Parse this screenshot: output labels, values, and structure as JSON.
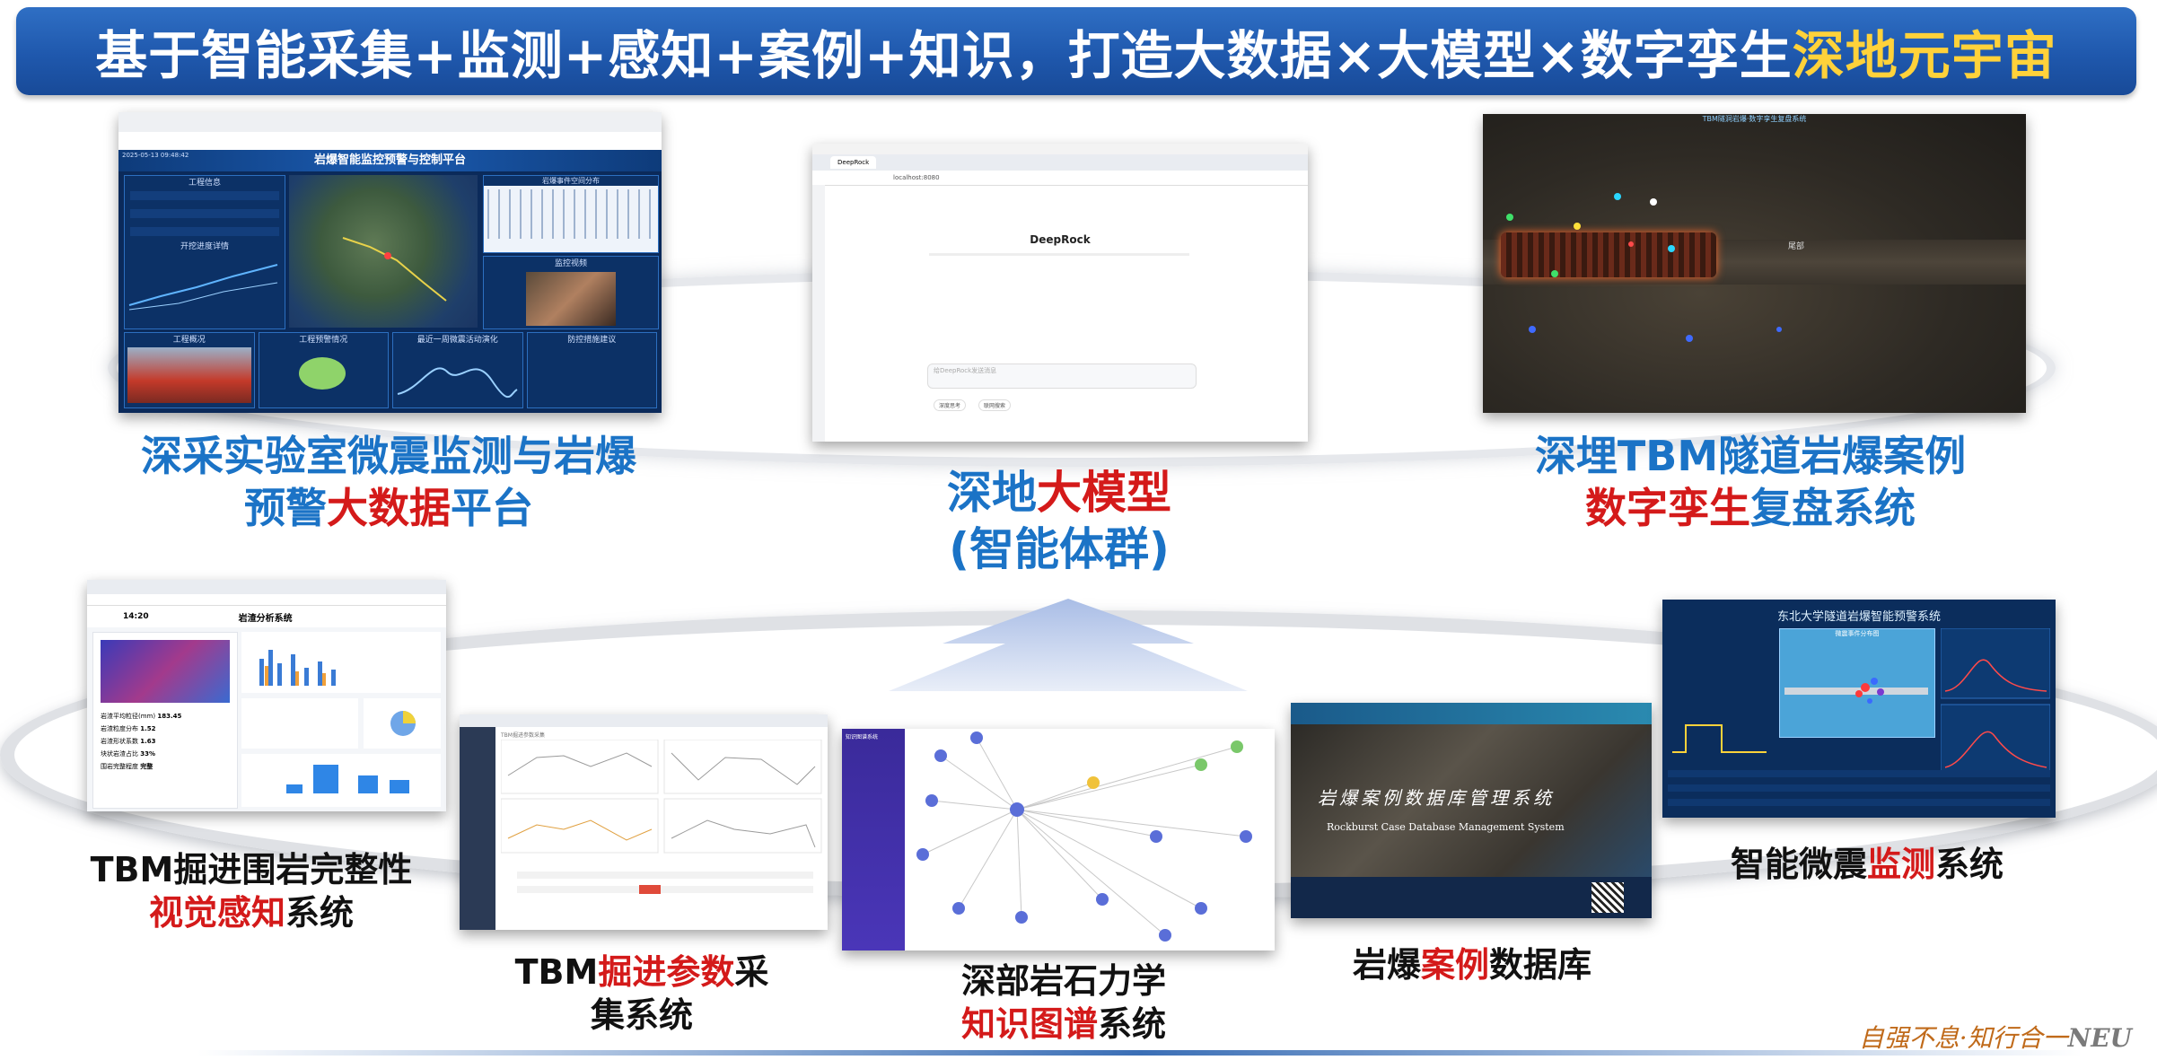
{
  "banner": {
    "main": "基于智能采集+监测+感知+案例+知识，打造大数据×大模型×数字孪生",
    "highlight": "深地元宇宙"
  },
  "captions": {
    "bigdata": {
      "l1": "深采实验室微震监测与岩爆",
      "l2a": "预警",
      "l2b": "大数据",
      "l2c": "平台"
    },
    "llm": {
      "l1a": "深地",
      "l1b": "大模型",
      "l2": "(智能体群)"
    },
    "twin": {
      "l1": "深埋TBM隧道岩爆案例",
      "l2a": "数字孪生",
      "l2b": "复盘系统"
    },
    "vision": {
      "l1": "TBM掘进围岩完整性",
      "l2a": "视觉感知",
      "l2b": "系统"
    },
    "params": {
      "l1a": "TBM",
      "l1b": "掘进参数",
      "l1c": "采",
      "l2": "集系统"
    },
    "kg": {
      "l1": "深部岩石力学",
      "l2a": "知识图谱",
      "l2b": "系统"
    },
    "casedb": {
      "l1a": "岩爆",
      "l1b": "案例",
      "l1c": "数据库"
    },
    "microseis": {
      "l1a": "智能微震",
      "l1b": "监测",
      "l1c": "系统"
    }
  },
  "screens": {
    "dashboard": {
      "title": "岩爆智能监控预警与控制平台",
      "date": "2025-05-13 09:48:42",
      "p1": "工程信息",
      "p2": "开挖进度详情",
      "p3": "岩爆事件空间分布",
      "p4": "监控视频",
      "p5": "工程概况",
      "p6": "工程预警情况",
      "p7": "最近一周微震活动演化",
      "p8": "防控措施建议"
    },
    "deeprock": {
      "tab": "DeepRock",
      "url": "localhost:8080",
      "title": "DeepRock",
      "input_placeholder": "给DeepRock发送消息",
      "btn1": "深度思考",
      "btn2": "联网搜索"
    },
    "twin": {
      "title": "TBM隧洞岩爆·数字孪生复盘系统",
      "label": "尾部"
    },
    "vision": {
      "title": "岩渣分析系统",
      "time": "14:20",
      "m1": "岩渣平均粒径(mm)",
      "v1": "183.45",
      "m2": "岩渣粒度分布",
      "v2": "1.52",
      "m3": "岩渣形状系数",
      "v3": "1.63",
      "m4": "块状岩渣占比",
      "v4": "33%",
      "m5": "围岩完整程度",
      "v5": "完整"
    },
    "params": {
      "title": "TBM掘进参数采集"
    },
    "kg": {
      "title": "知识图谱系统"
    },
    "casedb": {
      "title": "岩爆案例数据库管理系统",
      "subtitle": "Rockburst Case Database Management System"
    },
    "microseis": {
      "title": "东北大学隧道岩爆智能预警系统",
      "panel": "微震事件分布图"
    }
  },
  "footer": {
    "motto": "自强不息·知行合一",
    "org": "NEU"
  }
}
